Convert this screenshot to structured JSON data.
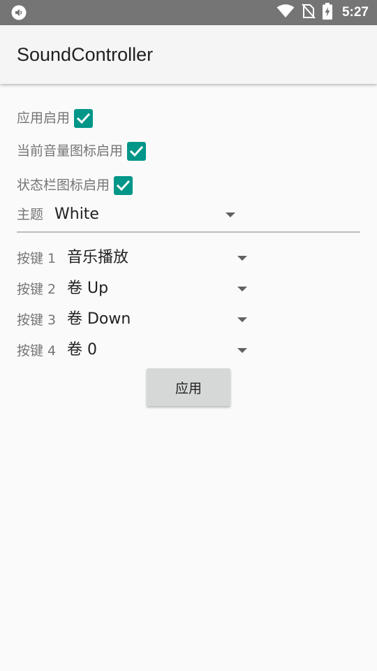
{
  "status_bar": {
    "time": "5:27",
    "icons": [
      "volume-notification-icon",
      "wifi-icon",
      "no-sim-icon",
      "battery-charging-icon"
    ]
  },
  "app_bar": {
    "title": "SoundController"
  },
  "settings": {
    "app_enabled": {
      "label": "应用启用",
      "checked": true
    },
    "current_volume_icon": {
      "label": "当前音量图标启用",
      "checked": true
    },
    "status_bar_icon": {
      "label": "状态栏图标启用",
      "checked": true
    },
    "theme": {
      "label": "主题",
      "value": "White"
    }
  },
  "keys": [
    {
      "label": "按键 1",
      "value": "音乐播放"
    },
    {
      "label": "按键 2",
      "value": "卷 Up"
    },
    {
      "label": "按键 3",
      "value": "卷 Down"
    },
    {
      "label": "按键 4",
      "value": "卷 0"
    }
  ],
  "apply_button": {
    "label": "应用"
  },
  "colors": {
    "accent": "#009688",
    "status_bar": "#757575",
    "app_bar": "#f5f5f5",
    "background": "#fafafa",
    "button": "#d6d7d7"
  }
}
